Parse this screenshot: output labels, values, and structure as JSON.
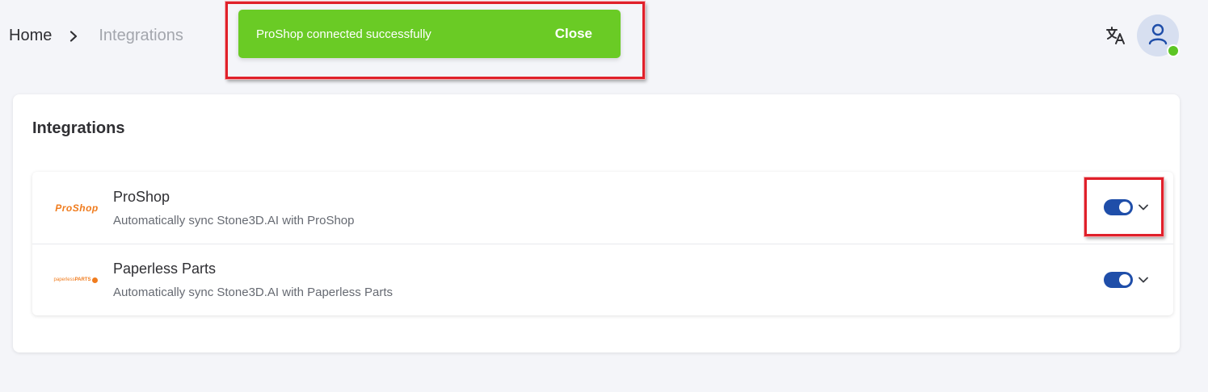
{
  "breadcrumb": {
    "home": "Home",
    "current": "Integrations"
  },
  "snackbar": {
    "message": "ProShop connected successfully",
    "close_label": "Close",
    "color": "#6acb25"
  },
  "header": {
    "translate_icon": "translate-icon",
    "avatar_icon": "user-icon",
    "status": "online"
  },
  "card": {
    "title": "Integrations"
  },
  "integrations": [
    {
      "name": "ProShop",
      "description": "Automatically sync Stone3D.AI with ProShop",
      "logo_text": "ProShop",
      "enabled": true
    },
    {
      "name": "Paperless Parts",
      "description": "Automatically sync Stone3D.AI with Paperless Parts",
      "logo_text_light": "paperless",
      "logo_text_bold": "PARTS",
      "enabled": true
    }
  ],
  "colors": {
    "accent": "#1f4ea9",
    "success": "#6acb25",
    "logo": "#f07c1e",
    "highlight": "#e0202a"
  }
}
